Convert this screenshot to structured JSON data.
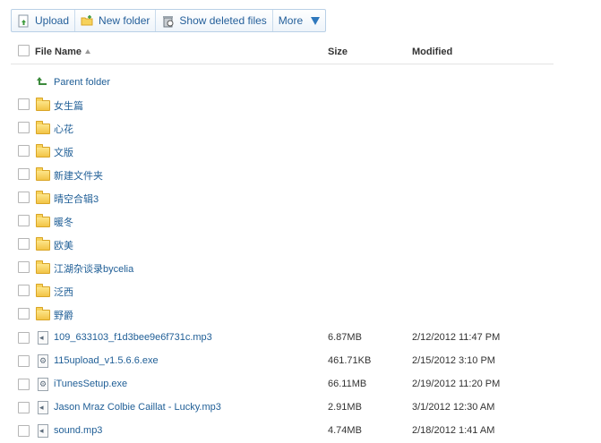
{
  "toolbar": {
    "upload": "Upload",
    "new_folder": "New folder",
    "show_deleted": "Show deleted files",
    "more": "More"
  },
  "columns": {
    "name": "File Name",
    "size": "Size",
    "modified": "Modified"
  },
  "parent_folder": "Parent folder",
  "folders": [
    "女生篇",
    "心花",
    "文版",
    "新建文件夹",
    "晴空合辑3",
    "暖冬",
    "欧美",
    "江湖杂谈录bycelia",
    "泛西",
    "野爵"
  ],
  "files": [
    {
      "name": "109_633103_f1d3bee9e6f731c.mp3",
      "size": "6.87MB",
      "modified": "2/12/2012 11:47 PM",
      "type": "audio"
    },
    {
      "name": "115upload_v1.5.6.6.exe",
      "size": "461.71KB",
      "modified": "2/15/2012 3:10 PM",
      "type": "exe"
    },
    {
      "name": "iTunesSetup.exe",
      "size": "66.11MB",
      "modified": "2/19/2012 11:20 PM",
      "type": "exe"
    },
    {
      "name": "Jason Mraz Colbie Caillat - Lucky.mp3",
      "size": "2.91MB",
      "modified": "3/1/2012 12:30 AM",
      "type": "audio"
    },
    {
      "name": "sound.mp3",
      "size": "4.74MB",
      "modified": "2/18/2012 1:41 AM",
      "type": "audio"
    }
  ],
  "colors": {
    "link": "#1f5e96",
    "toolbar_text": "#245f9a",
    "folder": "#f2c446"
  }
}
